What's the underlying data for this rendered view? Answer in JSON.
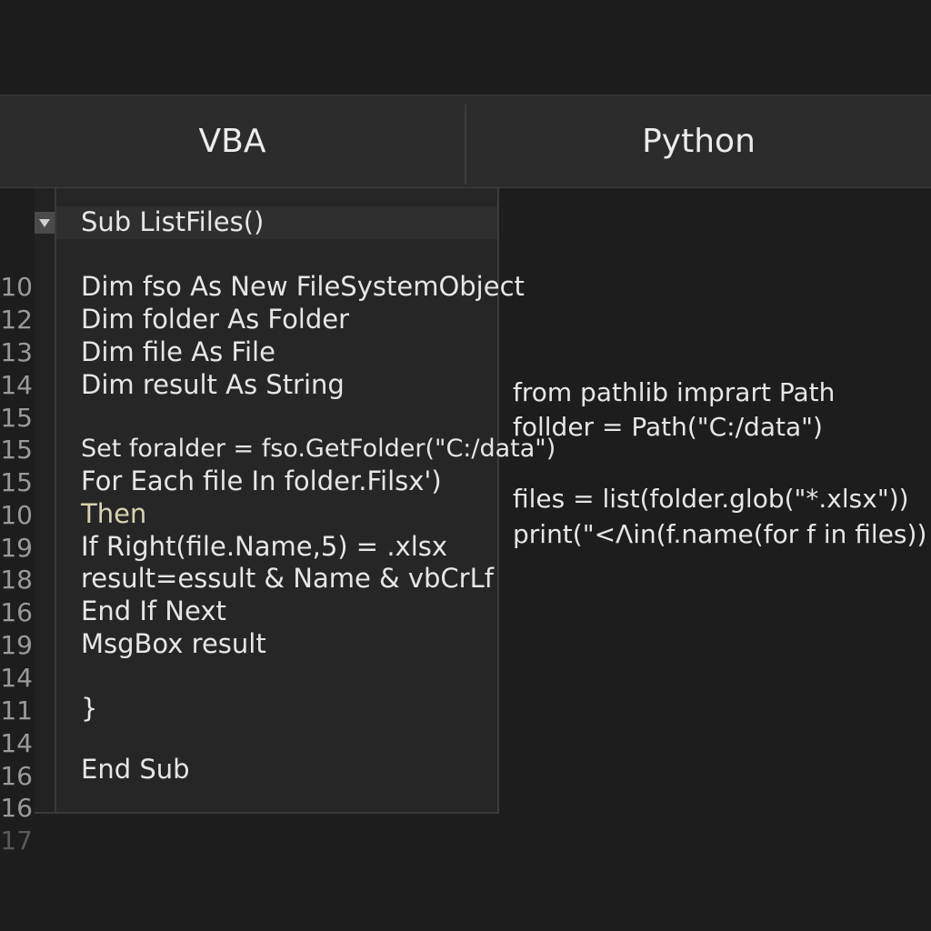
{
  "tabs": {
    "vba_label": "VBA",
    "python_label": "Python"
  },
  "vba": {
    "line_numbers": [
      "10",
      "12",
      "13",
      "14",
      "15",
      "15",
      "15",
      "10",
      "19",
      "18",
      "16",
      "19",
      "14",
      "11",
      "14",
      "16",
      "16",
      "17"
    ],
    "lines": {
      "sub": "Sub ListFiles()",
      "dim_fso": "Dim fso As New FileSystemObject",
      "dim_folder": "Dim folder As Folder",
      "dim_file": "Dim file As File",
      "dim_result": "Dim result As String",
      "set_folder": "Set foralder = fso.GetFolder(\"C:/data\")",
      "for_each": "For Each file In folder.Filsx')",
      "then": "Then",
      "if_right": "If Right(file.Name,5) = .xlsx",
      "result": "result=essult & Name & vbCrLf",
      "end_if_next": "End If Next",
      "msgbox": "MsgBox result",
      "brace": "}",
      "end_sub": "End Sub"
    }
  },
  "python": {
    "lines": {
      "import": "from pathlib imprart Path",
      "folder": "follder = Path(\"C:/data\")",
      "files": "files = list(folder.glob(\"*.xlsx\"))",
      "print": "print(\"<Λin(f.name(for f in files))"
    }
  },
  "colors": {
    "background": "#1d1d1d",
    "tab_bar": "#2c2c2c",
    "editor": "#262626",
    "text": "#e6e6e6",
    "line_number": "#9a9a9a"
  }
}
